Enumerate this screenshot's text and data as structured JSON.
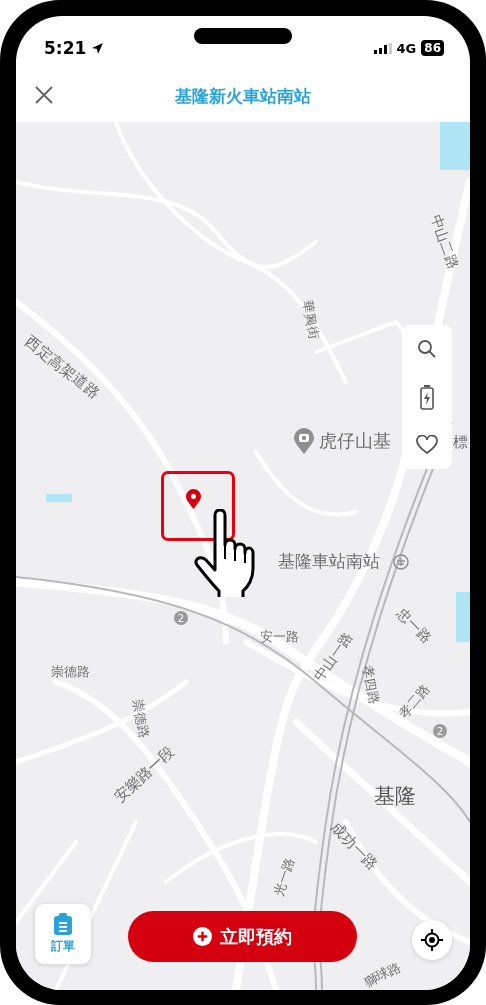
{
  "status_bar": {
    "time": "5:21",
    "network": "4G",
    "battery": "86"
  },
  "header": {
    "title": "基隆新火車站南站"
  },
  "map": {
    "labels": [
      {
        "text": "中山二路"
      },
      {
        "text": "華興街"
      },
      {
        "text": "西定高架道路"
      },
      {
        "text": "標"
      },
      {
        "text": "安一路"
      },
      {
        "text": "中山一路"
      },
      {
        "text": "忠一路"
      },
      {
        "text": "崇德路"
      },
      {
        "text": "崇德路"
      },
      {
        "text": "孝四路"
      },
      {
        "text": "孝二路"
      },
      {
        "text": "安樂路一段"
      },
      {
        "text": "成功一路"
      },
      {
        "text": "光一路"
      },
      {
        "text": "獅球路"
      }
    ],
    "poi": {
      "text": "虎仔山基"
    },
    "station": {
      "text": "基隆車站南站"
    },
    "city": {
      "text": "基隆"
    },
    "shields": [
      {
        "text": "2"
      },
      {
        "text": "2"
      }
    ]
  },
  "orders_button": {
    "label": "訂單"
  },
  "book_button": {
    "label": "立即預約"
  }
}
